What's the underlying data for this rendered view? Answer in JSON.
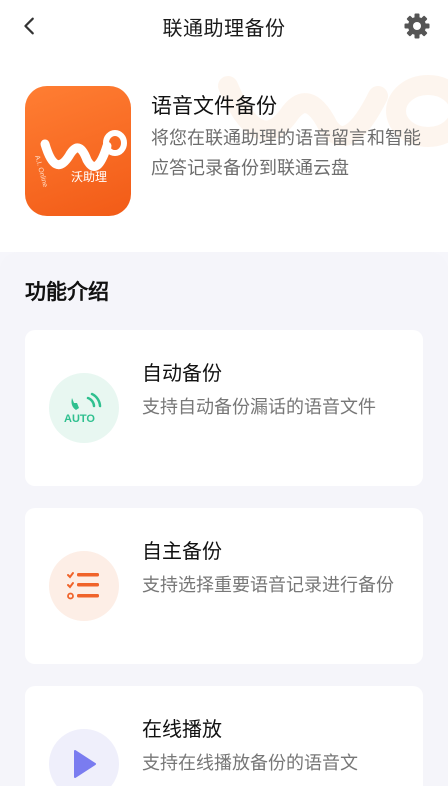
{
  "header": {
    "title": "联通助理备份",
    "back_icon": "chevron-left-icon",
    "settings_icon": "gear-icon"
  },
  "hero": {
    "logo_caption": "沃助理",
    "logo_side_text": "A.I. Online",
    "title": "语音文件备份",
    "description": "将您在联通助理的语音留言和智能应答记录备份到联通云盘"
  },
  "features": {
    "section_title": "功能介绍",
    "items": [
      {
        "title": "自动备份",
        "description": "支持自动备份漏话的语音文件",
        "icon": "auto-backup-icon",
        "icon_text": "AUTO",
        "icon_bg": "#e8f7f1",
        "icon_color": "#2fc08f"
      },
      {
        "title": "自主备份",
        "description": "支持选择重要语音记录进行备份",
        "icon": "checklist-icon",
        "icon_bg": "#fdeee6",
        "icon_color": "#f0632a"
      },
      {
        "title": "在线播放",
        "description": "支持在线播放备份的语音文",
        "icon": "play-icon",
        "icon_bg": "#efeffb",
        "icon_color": "#7a7cf0"
      }
    ]
  },
  "colors": {
    "brand_orange": "#f25b17",
    "accent_green": "#2fc08f",
    "accent_purple": "#7a7cf0"
  }
}
